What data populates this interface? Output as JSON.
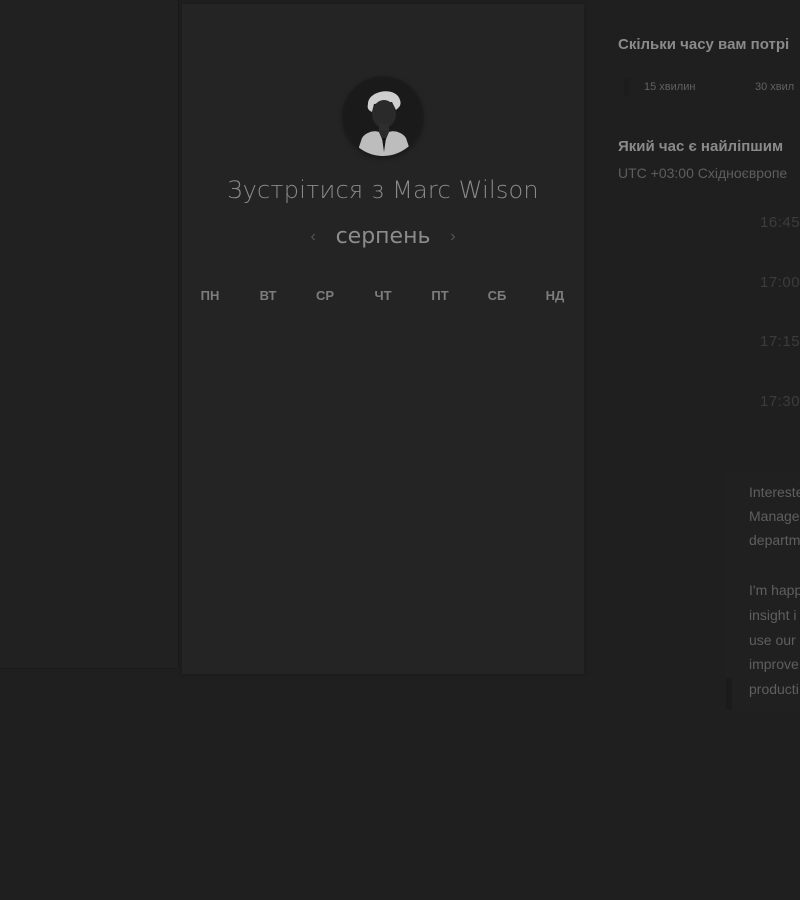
{
  "profile": {
    "title": "Зустрітися з Marc Wilson",
    "avatar_alt": "Marc Wilson"
  },
  "calendar": {
    "month": "серпень",
    "prev_icon": "chevron-left-icon",
    "next_icon": "chevron-right-icon",
    "weekdays": [
      "ПН",
      "ВТ",
      "СР",
      "ЧТ",
      "ПТ",
      "СБ",
      "НД"
    ]
  },
  "booking": {
    "duration_question": "Скільки часу вам потрі",
    "durations": [
      "15 хвилин",
      "30 хвил"
    ],
    "time_question": "Який час є найліпшим",
    "timezone": "UTC +03:00 Східноєвропе",
    "slots": [
      "16:45",
      "17:00",
      "17:15",
      "17:30"
    ]
  },
  "description": {
    "lines": [
      "Intereste",
      "Manage",
      "departm",
      "",
      "I'm happ",
      "insight i",
      "use our",
      "improve",
      "producti"
    ]
  },
  "colors": {
    "background": "#1f1f1f",
    "card": "#242424",
    "text_primary": "#8a8a8a",
    "text_muted": "#5e5e5e"
  }
}
